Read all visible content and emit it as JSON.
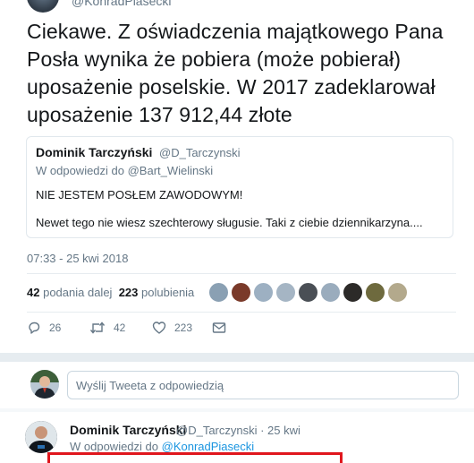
{
  "header": {
    "handle": "@KonradPiasecki"
  },
  "tweet": {
    "text": "Ciekawe. Z oświadczenia majątkowego Pana Posła wynika że pobiera (może pobierał) uposażenie poselskie. W 2017 zadeklarował uposażenie 137 912,44 złote",
    "timestamp": "07:33 - 25 kwi 2018"
  },
  "quote": {
    "name": "Dominik Tarczyński",
    "handle": "@D_Tarczynski",
    "reply_to": "W odpowiedzi do @Bart_Wielinski",
    "line1": "NIE JESTEM POSŁEM ZAWODOWYM!",
    "line2": "Newet tego nie wiesz szechterowy sługusie. Taki z ciebie dziennikarzyna...."
  },
  "stats": {
    "retweets_count": "42",
    "retweets_label": "podania dalej",
    "likes_count": "223",
    "likes_label": "polubienia"
  },
  "actions": {
    "replies": "26",
    "retweets": "42",
    "likes": "223"
  },
  "reply_box": {
    "placeholder": "Wyślij Tweeta z odpowiedzią"
  },
  "reply_tweet": {
    "name": "Dominik Tarczyński",
    "handle_time": "@D_Tarczynski · 25 kwi",
    "reply_prefix": "W odpowiedzi do ",
    "reply_link": "@KonradPiasecki"
  },
  "icons": {
    "reply": "reply-icon",
    "retweet": "retweet-icon",
    "like": "heart-icon",
    "message": "envelope-icon"
  },
  "colors": {
    "accent": "#1b95e0",
    "highlight_box": "#e0161d"
  }
}
